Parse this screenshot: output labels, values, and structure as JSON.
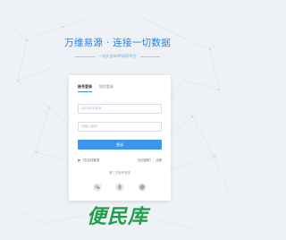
{
  "header": {
    "title": "万维易源 · 连接一切数据",
    "subtitle": "一站式全网API调用平台"
  },
  "login": {
    "tabs": [
      {
        "label": "账号登录",
        "active": true
      },
      {
        "label": "短信登录",
        "active": false
      }
    ],
    "phone_placeholder": "用户名/手机号",
    "password_placeholder": "请输入密码",
    "submit_label": "登录",
    "remember_label": "7天自动登录",
    "remember_checked": true,
    "forgot_label": "忘记密码?",
    "register_label": "注册",
    "third_party_title": "第三方账号登录",
    "third_party": [
      "wechat-icon",
      "qq-icon",
      "github-icon"
    ]
  },
  "watermark": {
    "text": "便民库"
  },
  "colors": {
    "accent": "#3a96ee",
    "title": "#2f7fd6",
    "watermark": "#1f9f4a",
    "background": "#eef2f6"
  }
}
